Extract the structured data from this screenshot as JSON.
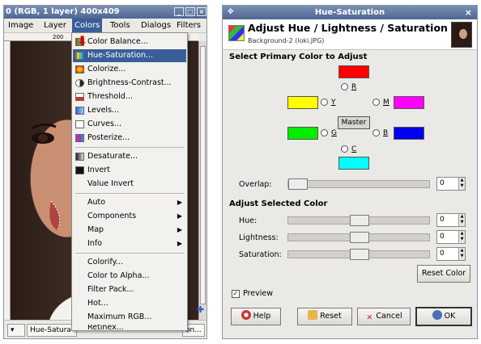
{
  "image_window": {
    "title": "0 (RGB, 1 layer) 400x409",
    "menu": [
      "Image",
      "Layer",
      "Colors",
      "Tools",
      "Dialogs",
      "Filters"
    ],
    "ruler_mark": "200",
    "status": {
      "unit_button": "▾",
      "layer_label": "Hue-Satura",
      "right_label": "on..."
    }
  },
  "colors_menu": {
    "items": [
      {
        "label": "Color Balance...",
        "icon": "color-balance-icon"
      },
      {
        "label": "Hue-Saturation...",
        "icon": "hue-saturation-icon",
        "highlighted": true
      },
      {
        "label": "Colorize...",
        "icon": "colorize-icon"
      },
      {
        "label": "Brightness-Contrast...",
        "icon": "brightness-contrast-icon"
      },
      {
        "label": "Threshold...",
        "icon": "threshold-icon"
      },
      {
        "label": "Levels...",
        "icon": "levels-icon"
      },
      {
        "label": "Curves...",
        "icon": "curves-icon"
      },
      {
        "label": "Posterize...",
        "icon": "posterize-icon"
      },
      {
        "label": "Desaturate...",
        "icon": "desaturate-icon"
      },
      {
        "label": "Invert",
        "icon": "invert-icon"
      },
      {
        "label": "Value Invert",
        "icon": ""
      },
      {
        "label": "Auto",
        "submenu": true
      },
      {
        "label": "Components",
        "submenu": true
      },
      {
        "label": "Map",
        "submenu": true
      },
      {
        "label": "Info",
        "submenu": true
      },
      {
        "label": "Colorify..."
      },
      {
        "label": "Color to Alpha..."
      },
      {
        "label": "Filter Pack..."
      },
      {
        "label": "Hot..."
      },
      {
        "label": "Maximum RGB..."
      },
      {
        "label": "Retinex..."
      }
    ]
  },
  "dialog": {
    "title": "Hue-Saturation",
    "header_title": "Adjust Hue / Lightness / Saturation",
    "header_subtitle": "Background-2 (loki.JPG)",
    "primary_section": "Select Primary Color to Adjust",
    "primaries": [
      {
        "key": "R",
        "color": "#ff0000"
      },
      {
        "key": "Y",
        "color": "#ffff00"
      },
      {
        "key": "M",
        "color": "#ff00ff"
      },
      {
        "key": "G",
        "color": "#00ee00"
      },
      {
        "key": "B",
        "color": "#0000ee"
      },
      {
        "key": "C",
        "color": "#00ffff"
      }
    ],
    "master_label": "Master",
    "overlap": {
      "label": "Overlap:",
      "value": "0"
    },
    "adjust_section": "Adjust Selected Color",
    "sliders": [
      {
        "label": "Hue:",
        "value": "0"
      },
      {
        "label": "Lightness:",
        "value": "0"
      },
      {
        "label": "Saturation:",
        "value": "0"
      }
    ],
    "reset_color_label": "Reset Color",
    "preview": {
      "label": "Preview",
      "checked": true
    },
    "buttons": {
      "help": "Help",
      "reset": "Reset",
      "cancel": "Cancel",
      "ok": "OK"
    }
  }
}
